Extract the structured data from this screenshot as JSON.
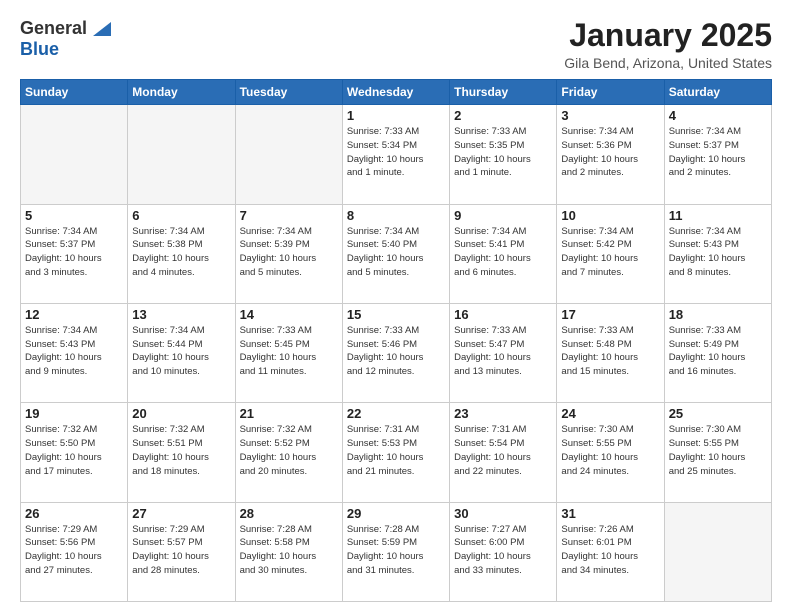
{
  "logo": {
    "general": "General",
    "blue": "Blue"
  },
  "header": {
    "month": "January 2025",
    "location": "Gila Bend, Arizona, United States"
  },
  "weekdays": [
    "Sunday",
    "Monday",
    "Tuesday",
    "Wednesday",
    "Thursday",
    "Friday",
    "Saturday"
  ],
  "weeks": [
    [
      {
        "day": "",
        "info": ""
      },
      {
        "day": "",
        "info": ""
      },
      {
        "day": "",
        "info": ""
      },
      {
        "day": "1",
        "info": "Sunrise: 7:33 AM\nSunset: 5:34 PM\nDaylight: 10 hours\nand 1 minute."
      },
      {
        "day": "2",
        "info": "Sunrise: 7:33 AM\nSunset: 5:35 PM\nDaylight: 10 hours\nand 1 minute."
      },
      {
        "day": "3",
        "info": "Sunrise: 7:34 AM\nSunset: 5:36 PM\nDaylight: 10 hours\nand 2 minutes."
      },
      {
        "day": "4",
        "info": "Sunrise: 7:34 AM\nSunset: 5:37 PM\nDaylight: 10 hours\nand 2 minutes."
      }
    ],
    [
      {
        "day": "5",
        "info": "Sunrise: 7:34 AM\nSunset: 5:37 PM\nDaylight: 10 hours\nand 3 minutes."
      },
      {
        "day": "6",
        "info": "Sunrise: 7:34 AM\nSunset: 5:38 PM\nDaylight: 10 hours\nand 4 minutes."
      },
      {
        "day": "7",
        "info": "Sunrise: 7:34 AM\nSunset: 5:39 PM\nDaylight: 10 hours\nand 5 minutes."
      },
      {
        "day": "8",
        "info": "Sunrise: 7:34 AM\nSunset: 5:40 PM\nDaylight: 10 hours\nand 5 minutes."
      },
      {
        "day": "9",
        "info": "Sunrise: 7:34 AM\nSunset: 5:41 PM\nDaylight: 10 hours\nand 6 minutes."
      },
      {
        "day": "10",
        "info": "Sunrise: 7:34 AM\nSunset: 5:42 PM\nDaylight: 10 hours\nand 7 minutes."
      },
      {
        "day": "11",
        "info": "Sunrise: 7:34 AM\nSunset: 5:43 PM\nDaylight: 10 hours\nand 8 minutes."
      }
    ],
    [
      {
        "day": "12",
        "info": "Sunrise: 7:34 AM\nSunset: 5:43 PM\nDaylight: 10 hours\nand 9 minutes."
      },
      {
        "day": "13",
        "info": "Sunrise: 7:34 AM\nSunset: 5:44 PM\nDaylight: 10 hours\nand 10 minutes."
      },
      {
        "day": "14",
        "info": "Sunrise: 7:33 AM\nSunset: 5:45 PM\nDaylight: 10 hours\nand 11 minutes."
      },
      {
        "day": "15",
        "info": "Sunrise: 7:33 AM\nSunset: 5:46 PM\nDaylight: 10 hours\nand 12 minutes."
      },
      {
        "day": "16",
        "info": "Sunrise: 7:33 AM\nSunset: 5:47 PM\nDaylight: 10 hours\nand 13 minutes."
      },
      {
        "day": "17",
        "info": "Sunrise: 7:33 AM\nSunset: 5:48 PM\nDaylight: 10 hours\nand 15 minutes."
      },
      {
        "day": "18",
        "info": "Sunrise: 7:33 AM\nSunset: 5:49 PM\nDaylight: 10 hours\nand 16 minutes."
      }
    ],
    [
      {
        "day": "19",
        "info": "Sunrise: 7:32 AM\nSunset: 5:50 PM\nDaylight: 10 hours\nand 17 minutes."
      },
      {
        "day": "20",
        "info": "Sunrise: 7:32 AM\nSunset: 5:51 PM\nDaylight: 10 hours\nand 18 minutes."
      },
      {
        "day": "21",
        "info": "Sunrise: 7:32 AM\nSunset: 5:52 PM\nDaylight: 10 hours\nand 20 minutes."
      },
      {
        "day": "22",
        "info": "Sunrise: 7:31 AM\nSunset: 5:53 PM\nDaylight: 10 hours\nand 21 minutes."
      },
      {
        "day": "23",
        "info": "Sunrise: 7:31 AM\nSunset: 5:54 PM\nDaylight: 10 hours\nand 22 minutes."
      },
      {
        "day": "24",
        "info": "Sunrise: 7:30 AM\nSunset: 5:55 PM\nDaylight: 10 hours\nand 24 minutes."
      },
      {
        "day": "25",
        "info": "Sunrise: 7:30 AM\nSunset: 5:55 PM\nDaylight: 10 hours\nand 25 minutes."
      }
    ],
    [
      {
        "day": "26",
        "info": "Sunrise: 7:29 AM\nSunset: 5:56 PM\nDaylight: 10 hours\nand 27 minutes."
      },
      {
        "day": "27",
        "info": "Sunrise: 7:29 AM\nSunset: 5:57 PM\nDaylight: 10 hours\nand 28 minutes."
      },
      {
        "day": "28",
        "info": "Sunrise: 7:28 AM\nSunset: 5:58 PM\nDaylight: 10 hours\nand 30 minutes."
      },
      {
        "day": "29",
        "info": "Sunrise: 7:28 AM\nSunset: 5:59 PM\nDaylight: 10 hours\nand 31 minutes."
      },
      {
        "day": "30",
        "info": "Sunrise: 7:27 AM\nSunset: 6:00 PM\nDaylight: 10 hours\nand 33 minutes."
      },
      {
        "day": "31",
        "info": "Sunrise: 7:26 AM\nSunset: 6:01 PM\nDaylight: 10 hours\nand 34 minutes."
      },
      {
        "day": "",
        "info": ""
      }
    ]
  ]
}
